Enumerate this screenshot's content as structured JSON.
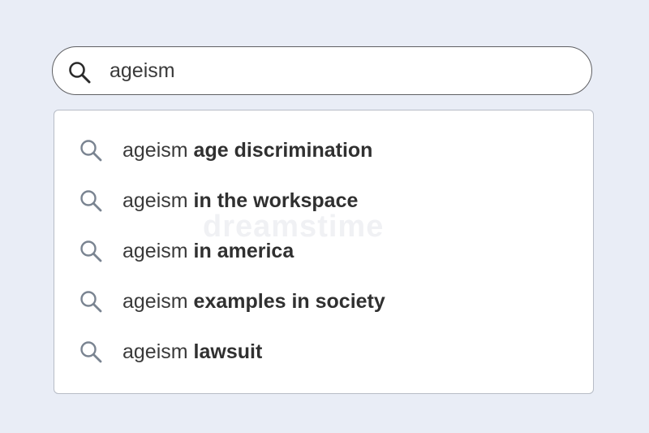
{
  "search": {
    "value": "ageism",
    "icon": "search-icon"
  },
  "suggestions": [
    {
      "query": "ageism",
      "completion": "age discrimination",
      "icon": "search-icon"
    },
    {
      "query": "ageism",
      "completion": "in the workspace",
      "icon": "search-icon"
    },
    {
      "query": "ageism",
      "completion": "in america",
      "icon": "search-icon"
    },
    {
      "query": "ageism",
      "completion": "examples in society",
      "icon": "search-icon"
    },
    {
      "query": "ageism",
      "completion": "lawsuit",
      "icon": "search-icon"
    }
  ],
  "watermark": "dreamstime",
  "colors": {
    "page_background": "#e9edf6",
    "bar_border": "#5f6063",
    "suggestion_icon": "#7a8491",
    "bar_icon": "#2b2b2b",
    "text": "#333333"
  }
}
